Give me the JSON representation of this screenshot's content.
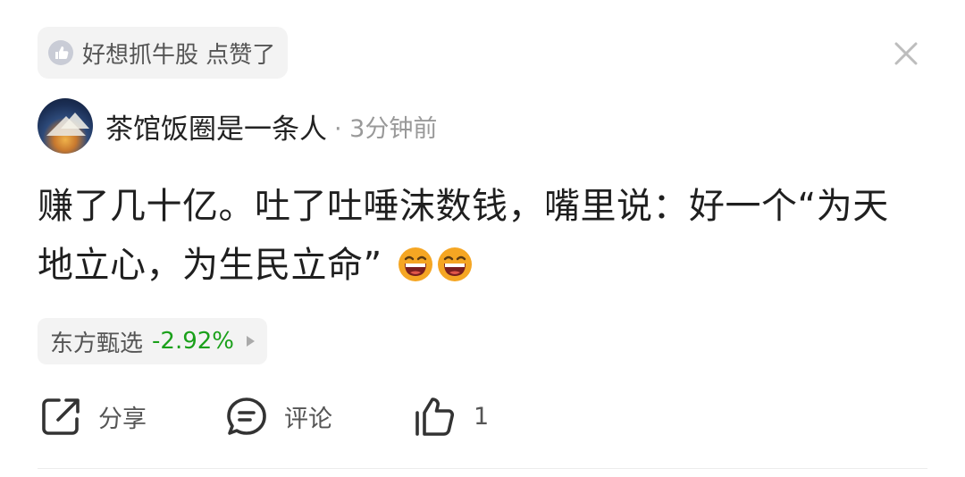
{
  "like_banner": {
    "text": "好想抓牛股 点赞了",
    "icon": "thumbs-up-circle-icon"
  },
  "close": {
    "icon": "close-icon"
  },
  "author": {
    "name": "茶馆饭圈是一条人",
    "time": "· 3分钟前",
    "avatar": "mountain-sunset-avatar"
  },
  "post": {
    "text": "赚了几十亿。吐了吐唾沫数钱，嘴里说：好一个“为天地立心，为生民立命”",
    "emojis": [
      "laughing-emoji",
      "laughing-emoji"
    ]
  },
  "stock": {
    "name": "东方甄选",
    "change": "-2.92%",
    "change_color": "#1aa01a"
  },
  "actions": {
    "share": {
      "label": "分享",
      "icon": "share-icon"
    },
    "comment": {
      "label": "评论",
      "icon": "comment-icon"
    },
    "like": {
      "count": "1",
      "icon": "thumbs-up-icon"
    }
  }
}
